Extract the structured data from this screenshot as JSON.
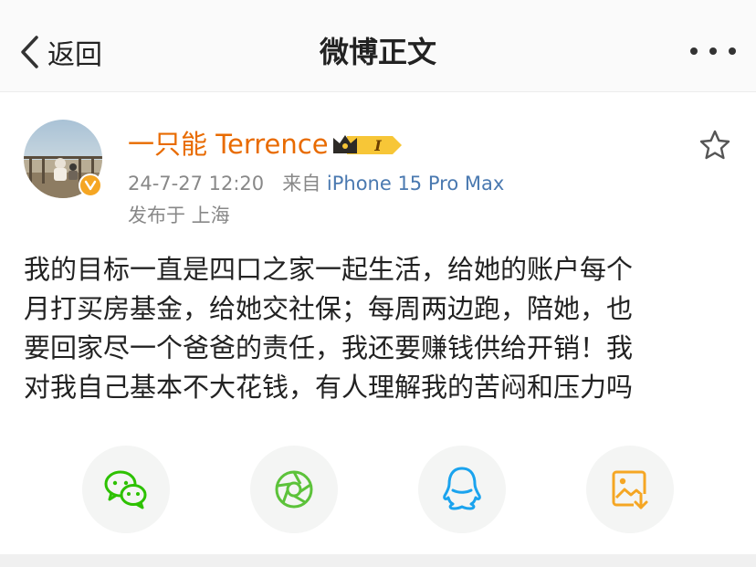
{
  "nav": {
    "back_label": "返回",
    "title": "微博正文"
  },
  "author": {
    "name": "一只能 Terrence",
    "member_level": "I",
    "timestamp": "24-7-27 12:20",
    "source_prefix": "来自",
    "source_device": "iPhone 15 Pro Max",
    "location": "发布于 上海"
  },
  "post": {
    "lines": [
      "我的目标一直是四口之家一起生活，给她的账户每个",
      "月打买房基金，给她交社保；每周两边跑，陪她，也",
      "要回家尽一个爸爸的责任，我还要赚钱供给开销！我",
      "对我自己基本不大花钱，有人理解我的苦闷和压力吗"
    ]
  },
  "share": {
    "items": [
      {
        "icon": "wechat-icon",
        "color": "#2dc100"
      },
      {
        "icon": "moments-icon",
        "color": "#5cc23a"
      },
      {
        "icon": "qq-icon",
        "color": "#1aa3ee"
      },
      {
        "icon": "save-image-icon",
        "color": "#f5a623"
      }
    ]
  },
  "colors": {
    "username": "#e86b00",
    "meta_text": "#888888",
    "source_link": "#4a79b0",
    "verified_badge": "#f5a623"
  }
}
